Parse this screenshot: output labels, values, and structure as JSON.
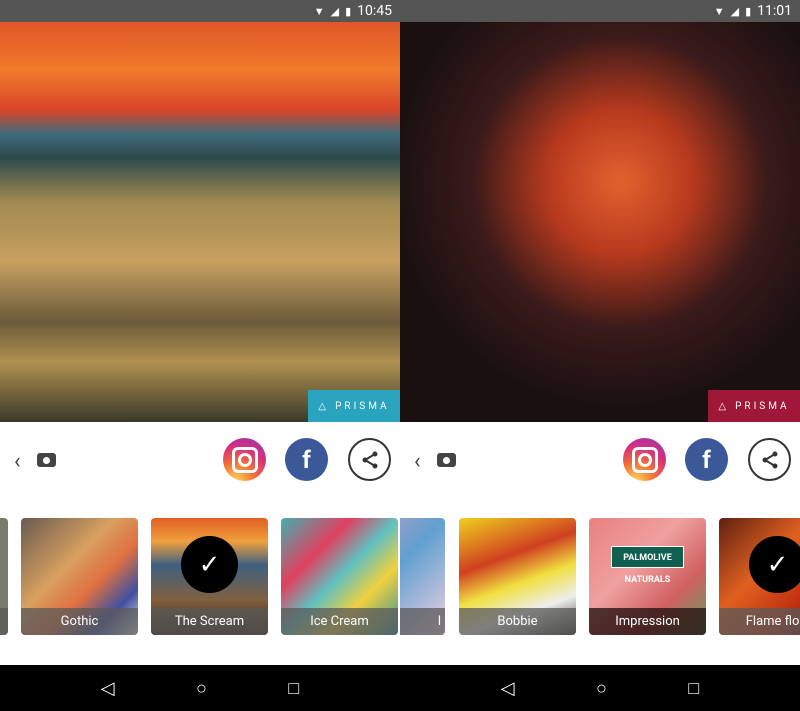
{
  "left": {
    "status": {
      "time": "10:45"
    },
    "badge": {
      "text": "PRISMA",
      "color": "#2aa3bf"
    },
    "thumbs": [
      {
        "label": ""
      },
      {
        "label": "Gothic"
      },
      {
        "label": "The Scream",
        "selected": true
      },
      {
        "label": "Ice Cream"
      }
    ]
  },
  "right": {
    "status": {
      "time": "11:01"
    },
    "badge": {
      "text": "PRISMA",
      "color": "#a01838"
    },
    "thumbs": [
      {
        "label": "l"
      },
      {
        "label": "Bobbie"
      },
      {
        "label": "Impression",
        "overlay": "PALMOLIVE NATURALS"
      },
      {
        "label": "Flame flow",
        "selected": true
      }
    ]
  },
  "actions": {
    "facebook": "f",
    "check": "✓"
  },
  "icons": {
    "back": "‹",
    "share": "share-icon",
    "nav": [
      "◁",
      "○",
      "□"
    ]
  }
}
